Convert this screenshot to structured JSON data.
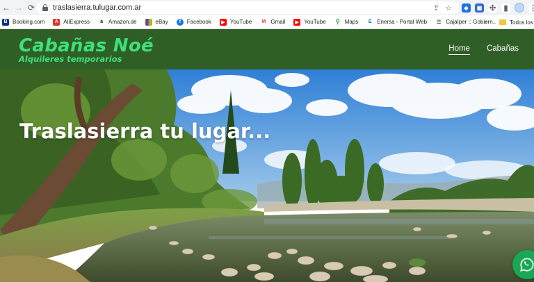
{
  "browser": {
    "url": "traslasierra.tulugar.com.ar",
    "back_icon": "back-arrow-icon",
    "forward_icon": "forward-arrow-icon",
    "reload_icon": "reload-icon"
  },
  "bookmarks": {
    "items": [
      {
        "label": "Booking.com",
        "icon": "booking-icon",
        "color": "#003580"
      },
      {
        "label": "AliExpress",
        "icon": "aliexpress-icon",
        "color": "#e43225"
      },
      {
        "label": "Amazon.de",
        "icon": "amazon-icon",
        "color": "#222222"
      },
      {
        "label": "eBay",
        "icon": "ebay-icon",
        "color": "#e53238"
      },
      {
        "label": "Facebook",
        "icon": "facebook-icon",
        "color": "#1877f2"
      },
      {
        "label": "YouTube",
        "icon": "youtube-icon",
        "color": "#ff0000"
      },
      {
        "label": "Gmail",
        "icon": "gmail-icon",
        "color": "#ea4335"
      },
      {
        "label": "YouTube",
        "icon": "youtube-icon",
        "color": "#ff0000"
      },
      {
        "label": "Maps",
        "icon": "maps-icon",
        "color": "#34a853"
      },
      {
        "label": "Enersa - Portal Web",
        "icon": "enersa-icon",
        "color": "#0a7bc1"
      },
      {
        "label": "CajaIper :: Gobiern...",
        "icon": "cajaiper-icon",
        "color": "#555555"
      }
    ],
    "more": "»",
    "folder_label": "Todos los fa"
  },
  "site": {
    "brand_title": "Cabañas Noé",
    "brand_subtitle": "Alquileres temporarios",
    "nav": [
      {
        "label": "Home",
        "active": true
      },
      {
        "label": "Cabañas",
        "active": false
      }
    ],
    "hero_title": "Traslasierra tu lugar...",
    "colors": {
      "header_bg": "#2f5e27",
      "brand": "#3ee07a",
      "whatsapp": "#1aa754"
    }
  }
}
